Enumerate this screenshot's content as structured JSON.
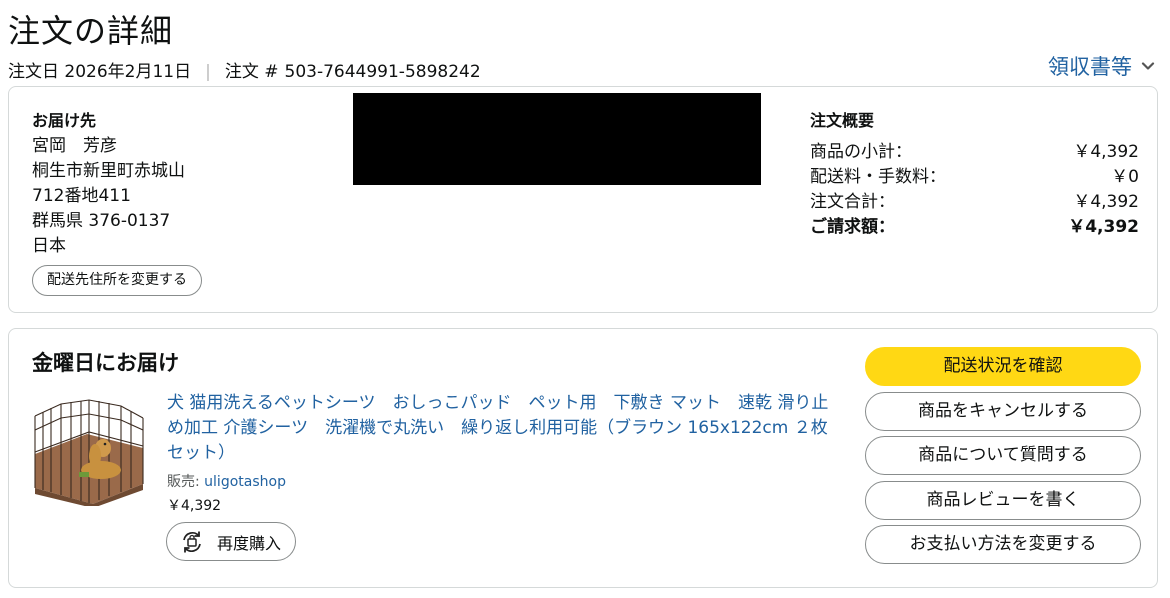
{
  "header": {
    "title": "注文の詳細",
    "order_date": "注文日 2026年2月11日",
    "separator": "|",
    "order_number_label": "注文 #",
    "order_number": "503-7644991-5898242",
    "invoices_link": "領収書等"
  },
  "shipping": {
    "heading": "お届け先",
    "name": "宮岡　芳彦",
    "address_line1": "桐生市新里町赤城山",
    "address_line2": "712番地411",
    "address_line3": "群馬県 376-0137",
    "country": "日本",
    "change_button": "配送先住所を変更する"
  },
  "summary": {
    "heading": "注文概要",
    "rows": [
      {
        "label": "商品の小計：",
        "value": "￥4,392"
      },
      {
        "label": "配送料・手数料：",
        "value": "￥0"
      },
      {
        "label": "注文合計：",
        "value": "￥4,392"
      },
      {
        "label": "ご請求額：",
        "value": "￥4,392"
      }
    ]
  },
  "delivery": {
    "heading": "金曜日にお届け",
    "product": {
      "title": "犬 猫用洗えるペットシーツ　おしっこパッド　ペット用　下敷き マット　速乾 滑り止め加工 介護シーツ　洗濯機で丸洗い　繰り返し利用可能（ブラウン 165x122cm ２枚セット）",
      "seller_label": "販売:",
      "seller_name": "uligotashop",
      "price": "￥4,392",
      "rebuy_button": "再度購入"
    },
    "actions": [
      "配送状況を確認",
      "商品をキャンセルする",
      "商品について質問する",
      "商品レビューを書く",
      "お支払い方法を変更する"
    ]
  },
  "colors": {
    "link": "#2162a1",
    "primary_button": "#ffd814",
    "border": "#d5d9d9",
    "text": "#0f1111"
  },
  "icons": {
    "invoices": "chevron-down-icon",
    "rebuy": "rebuy-cycle-icon"
  }
}
